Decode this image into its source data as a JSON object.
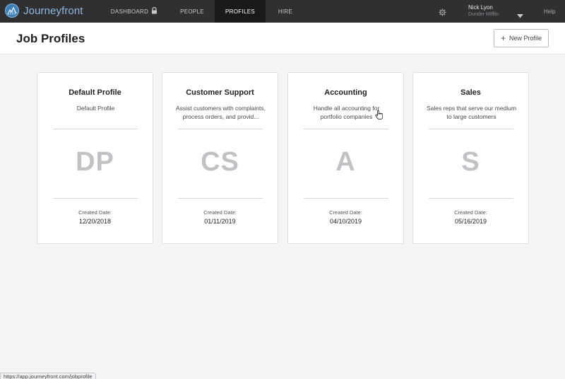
{
  "app": {
    "brand_name": "Journeyfront"
  },
  "nav": {
    "items": [
      {
        "label": "DASHBOARD"
      },
      {
        "label": "PEOPLE"
      },
      {
        "label": "PROFILES"
      },
      {
        "label": "HIRE"
      }
    ],
    "active": "PROFILES",
    "help_label": "Help"
  },
  "user": {
    "name": "Nick Lyon",
    "org": "Dunder Mifflin"
  },
  "header": {
    "title": "Job Profiles",
    "new_button_label": "New Profile"
  },
  "cards": [
    {
      "title": "Default Profile",
      "desc1": "Default Profile",
      "desc2": "",
      "initials": "DP",
      "created_label": "Created Date:",
      "created_date": "12/20/2018"
    },
    {
      "title": "Customer Support",
      "desc1": "Assist customers with complaints,",
      "desc2": "process orders, and provid...",
      "initials": "CS",
      "created_label": "Created Date:",
      "created_date": "01/11/2019"
    },
    {
      "title": "Accounting",
      "desc1": "Handle all accounting for",
      "desc2": "portfolio companies",
      "initials": "A",
      "created_label": "Created Date:",
      "created_date": "04/10/2019"
    },
    {
      "title": "Sales",
      "desc1": "Sales reps that serve our medium",
      "desc2": "to large customers",
      "initials": "S",
      "created_label": "Created Date:",
      "created_date": "05/16/2019"
    }
  ],
  "status_bar": {
    "url": "https://app.journeyfront.com/jobprofile"
  },
  "colors": {
    "nav_bg": "#303033",
    "nav_active_bg": "#19191b",
    "brand": "#8fb8de",
    "page_bg": "#f5f5f6"
  },
  "icons": {
    "dashboard_lock": "lock-icon",
    "settings": "gear-icon",
    "user_menu": "caret-down-icon",
    "new_profile": "plus-icon"
  }
}
